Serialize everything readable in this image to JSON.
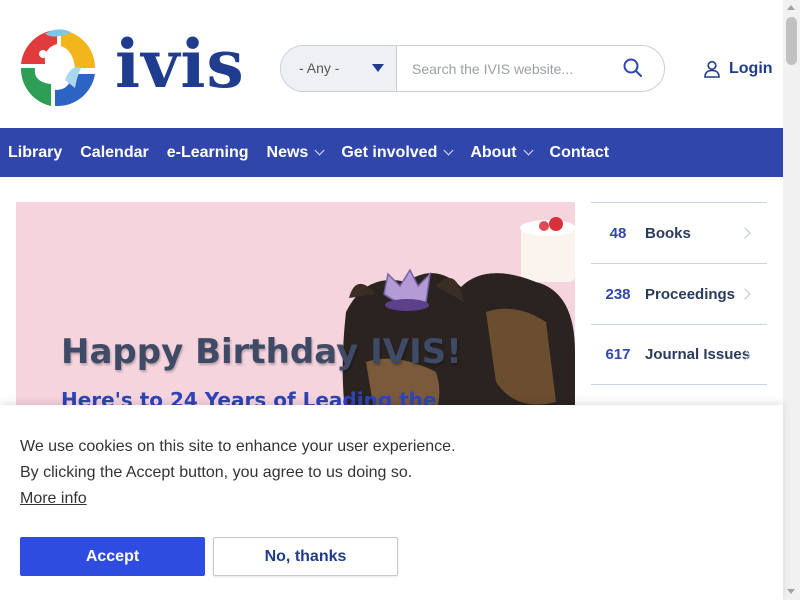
{
  "brand": {
    "name": "ivis",
    "colors": {
      "primary": "#1f3c8f",
      "nav": "#3046aa",
      "accent": "#2f4ce0"
    }
  },
  "search": {
    "select_value": "- Any -",
    "placeholder": "Search the IVIS website...",
    "icon": "search-icon"
  },
  "login": {
    "label": "Login",
    "icon": "user-icon"
  },
  "nav": {
    "items": [
      {
        "label": "Library",
        "dropdown": false
      },
      {
        "label": "Calendar",
        "dropdown": false
      },
      {
        "label": "e-Learning",
        "dropdown": false
      },
      {
        "label": "News",
        "dropdown": true
      },
      {
        "label": "Get involved",
        "dropdown": true
      },
      {
        "label": "About",
        "dropdown": true
      },
      {
        "label": "Contact",
        "dropdown": false
      }
    ]
  },
  "hero": {
    "title": "Happy Birthday IVIS!",
    "subtitle": "Here's to 24 Years of Leading the"
  },
  "stats": [
    {
      "count": "48",
      "label": "Books"
    },
    {
      "count": "238",
      "label": "Proceedings"
    },
    {
      "count": "617",
      "label": "Journal Issues"
    }
  ],
  "cookie": {
    "line1": "We use cookies on this site to enhance your user experience.",
    "line2": "By clicking the Accept button, you agree to us doing so.",
    "more_info": "More info",
    "accept": "Accept",
    "decline": "No, thanks"
  }
}
